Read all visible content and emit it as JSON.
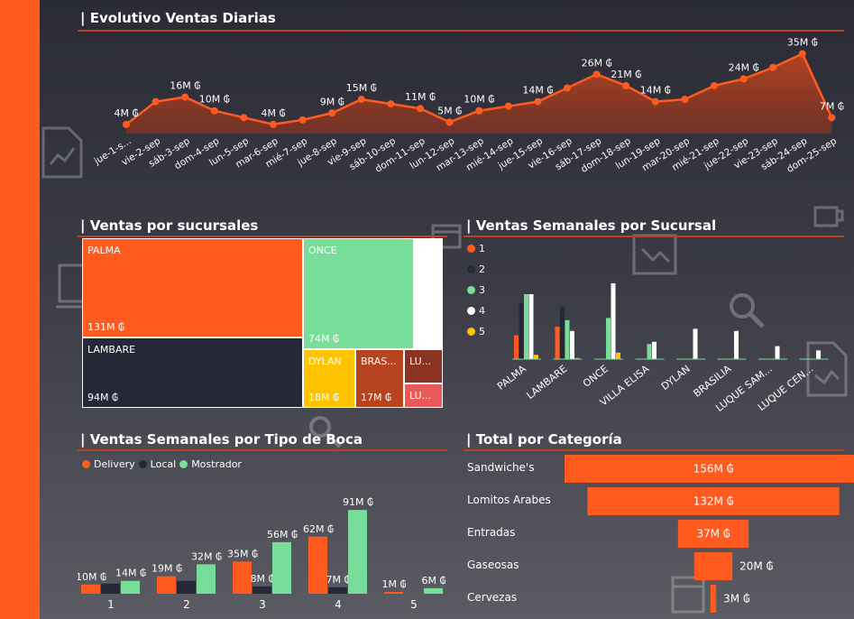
{
  "titles": {
    "daily": "| Evolutivo Ventas Diarias",
    "branches": "| Ventas por sucursales",
    "weekly_branch": "| Ventas Semanales por Sucursal",
    "weekly_type": "| Ventas Semanales por Tipo de Boca",
    "category": "| Total por Categoría"
  },
  "colors": {
    "accent": "#ff5a1f",
    "dark": "#252836",
    "green": "#77dd99",
    "white": "#ffffff",
    "yellow": "#ffc400",
    "brown": "#b8431f",
    "darkred": "#8a3322",
    "pink": "#e85a5a"
  },
  "chart_data": [
    {
      "type": "area",
      "id": "daily",
      "categories": [
        "jue-1-s...",
        "vie-2-sep",
        "sáb-3-sep",
        "dom-4-sep",
        "lun-5-sep",
        "mar-6-sep",
        "mié-7-sep",
        "jue-8-sep",
        "vie-9-sep",
        "sáb-10-sep",
        "dom-11-sep",
        "lun-12-sep",
        "mar-13-sep",
        "mié-14-sep",
        "jue-15-sep",
        "vie-16-sep",
        "sáb-17-sep",
        "dom-18-sep",
        "lun-19-sep",
        "mar-20-sep",
        "mié-21-sep",
        "jue-22-sep",
        "vie-23-sep",
        "sáb-24-sep",
        "dom-25-sep"
      ],
      "values": [
        4,
        14,
        16,
        10,
        7,
        4,
        6,
        9,
        15,
        13,
        11,
        5,
        10,
        12,
        14,
        20,
        26,
        21,
        14,
        15,
        21,
        24,
        29,
        35,
        7
      ],
      "data_labels": [
        "4M ₲",
        "",
        "16M ₲",
        "10M ₲",
        "",
        "4M ₲",
        "",
        "9M ₲",
        "15M ₲",
        "",
        "11M ₲",
        "5M ₲",
        "10M ₲",
        "",
        "14M ₲",
        "",
        "26M ₲",
        "21M ₲",
        "14M ₲",
        "",
        "",
        "24M ₲",
        "",
        "35M ₲",
        "7M ₲"
      ],
      "ylim": [
        0,
        38
      ]
    },
    {
      "type": "treemap",
      "id": "branches",
      "items": [
        {
          "name": "PALMA",
          "value": 131,
          "label": "131M ₲",
          "color": "#ff5a1f"
        },
        {
          "name": "LAMBARE",
          "value": 94,
          "label": "94M ₲",
          "color": "#252836"
        },
        {
          "name": "ONCE",
          "value": 74,
          "label": "74M ₲",
          "color": "#77dd99"
        },
        {
          "name": "",
          "value": 30,
          "label": "",
          "color": "#ffffff"
        },
        {
          "name": "DYLAN",
          "value": 18,
          "label": "18M ₲",
          "color": "#ffc400"
        },
        {
          "name": "BRAS...",
          "value": 17,
          "label": "17M ₲",
          "color": "#b8431f"
        },
        {
          "name": "LU...",
          "value": 9,
          "label": "",
          "color": "#8a3322"
        },
        {
          "name": "LU...",
          "value": 7,
          "label": "",
          "color": "#e85a5a"
        }
      ]
    },
    {
      "type": "bar",
      "id": "weekly_branch",
      "categories": [
        "PALMA",
        "LAMBARE",
        "ONCE",
        "VILLA ELISA",
        "DYLAN",
        "BRASILIA",
        "LUQUE SAM...",
        "LUQUE CEN..."
      ],
      "series": [
        {
          "name": "1",
          "color": "#ff5a1f",
          "values": [
            11,
            15,
            0,
            0,
            0,
            0,
            0,
            0
          ]
        },
        {
          "name": "2",
          "color": "#252836",
          "values": [
            26,
            24,
            0,
            0,
            0,
            0,
            0,
            0
          ]
        },
        {
          "name": "3",
          "color": "#77dd99",
          "values": [
            30,
            18,
            19,
            7,
            0,
            0,
            0,
            0
          ]
        },
        {
          "name": "4",
          "color": "#ffffff",
          "values": [
            30,
            13,
            35,
            8,
            14,
            13,
            6,
            4
          ]
        },
        {
          "name": "5",
          "color": "#ffc400",
          "values": [
            2,
            0.5,
            3,
            0,
            0,
            0,
            0,
            0
          ]
        }
      ],
      "ylim": [
        0,
        40
      ]
    },
    {
      "type": "bar",
      "id": "weekly_type",
      "categories": [
        "1",
        "2",
        "3",
        "4",
        "5"
      ],
      "series": [
        {
          "name": "Delivery",
          "color": "#ff5a1f",
          "values": [
            10,
            19,
            35,
            62,
            1
          ],
          "labels": [
            "10M ₲",
            "19M ₲",
            "35M ₲",
            "62M ₲",
            "1M ₲"
          ]
        },
        {
          "name": "Local",
          "color": "#252836",
          "values": [
            11,
            14,
            8,
            7,
            0
          ],
          "labels": [
            "",
            "",
            "8M ₲",
            "7M ₲",
            ""
          ]
        },
        {
          "name": "Mostrador",
          "color": "#77dd99",
          "values": [
            14,
            32,
            56,
            91,
            6
          ],
          "labels": [
            "14M ₲",
            "32M ₲",
            "56M ₲",
            "91M ₲",
            "6M ₲"
          ]
        }
      ],
      "ylim": [
        0,
        100
      ]
    },
    {
      "type": "bar",
      "id": "category",
      "orientation": "horizontal-funnel",
      "categories": [
        "Sandwiche's",
        "Lomitos Arabes",
        "Entradas",
        "Gaseosas",
        "Cervezas"
      ],
      "values": [
        156,
        132,
        37,
        20,
        3
      ],
      "labels": [
        "156M ₲",
        "132M ₲",
        "37M ₲",
        "20M ₲",
        "3M ₲"
      ]
    }
  ]
}
